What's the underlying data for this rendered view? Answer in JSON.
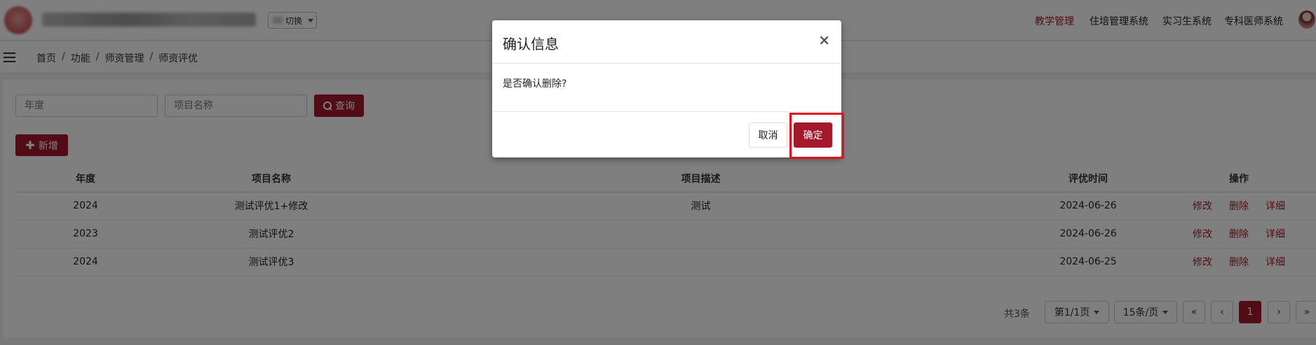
{
  "header": {
    "switch_label": "切换",
    "nav": [
      "教学管理",
      "住培管理系统",
      "实习生系统",
      "专科医师系统"
    ]
  },
  "breadcrumb": [
    "首页",
    "功能",
    "师资管理",
    "师资评优"
  ],
  "breadcrumb_sep": "/",
  "filters": {
    "year_placeholder": "年度",
    "name_placeholder": "项目名称",
    "search_label": "查询"
  },
  "add_label": "新增",
  "table": {
    "headers": [
      "年度",
      "项目名称",
      "项目描述",
      "评优时间",
      "操作"
    ],
    "rows": [
      {
        "year": "2024",
        "name": "测试评优1+修改",
        "desc": "测试",
        "date": "2024-06-26"
      },
      {
        "year": "2023",
        "name": "测试评优2",
        "desc": "",
        "date": "2024-06-26"
      },
      {
        "year": "2024",
        "name": "测试评优3",
        "desc": "",
        "date": "2024-06-25"
      }
    ],
    "actions": {
      "edit": "修改",
      "delete": "删除",
      "detail": "详细"
    }
  },
  "pagination": {
    "total": "共3条",
    "page_info": "第1/1页",
    "page_size": "15条/页",
    "first": "«",
    "prev": "‹",
    "current": "1",
    "next": "›",
    "last": "»"
  },
  "modal": {
    "title": "确认信息",
    "close": "×",
    "message": "是否确认删除?",
    "cancel": "取消",
    "confirm": "确定"
  },
  "colors": {
    "primary": "#a3192b",
    "highlight": "#e0141e"
  }
}
